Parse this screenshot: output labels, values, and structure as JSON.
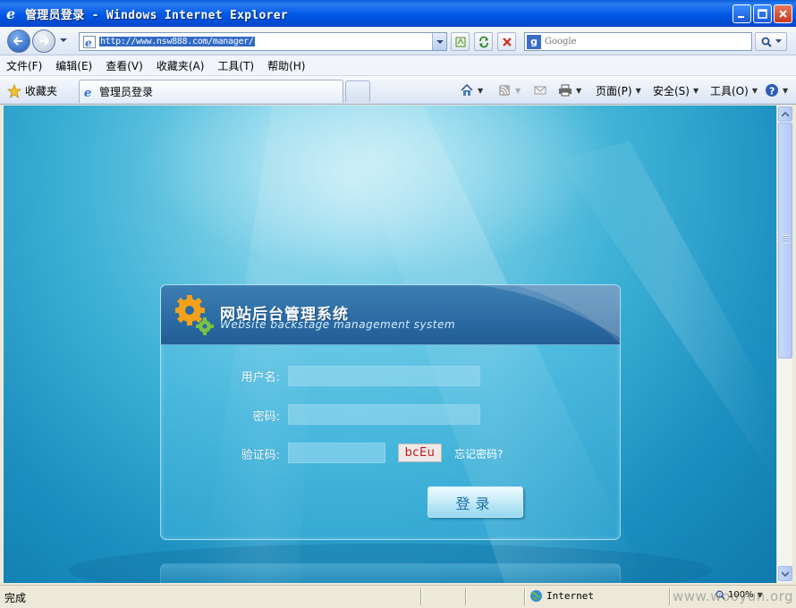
{
  "window": {
    "title": "管理员登录 - Windows Internet Explorer"
  },
  "address": {
    "url": "http://www.nsw888.com/manager/"
  },
  "search": {
    "placeholder": "Google",
    "engine_letter": "g"
  },
  "menu": {
    "items": [
      "文件(F)",
      "编辑(E)",
      "查看(V)",
      "收藏夹(A)",
      "工具(T)",
      "帮助(H)"
    ]
  },
  "tabs": {
    "favorites_label": "收藏夹",
    "active_tab": "管理员登录"
  },
  "commands": {
    "page": "页面(P)",
    "safety": "安全(S)",
    "tools": "工具(O)"
  },
  "login": {
    "title": "网站后台管理系统",
    "subtitle": "Website backstage management system",
    "username_label": "用户名:",
    "password_label": "密码:",
    "captcha_label": "验证码:",
    "captcha_value": "bcEu",
    "forgot_link": "忘记密码?",
    "submit_label": "登录"
  },
  "status": {
    "text": "完成",
    "zone": "Internet",
    "zoom": "100%"
  },
  "watermark": "www.wooyun.org",
  "colors": {
    "titlebar": "#0058e6",
    "panel_header": "#2b6aa3",
    "captcha_text": "#c0161c",
    "background_blue": "#3fb2d6"
  }
}
